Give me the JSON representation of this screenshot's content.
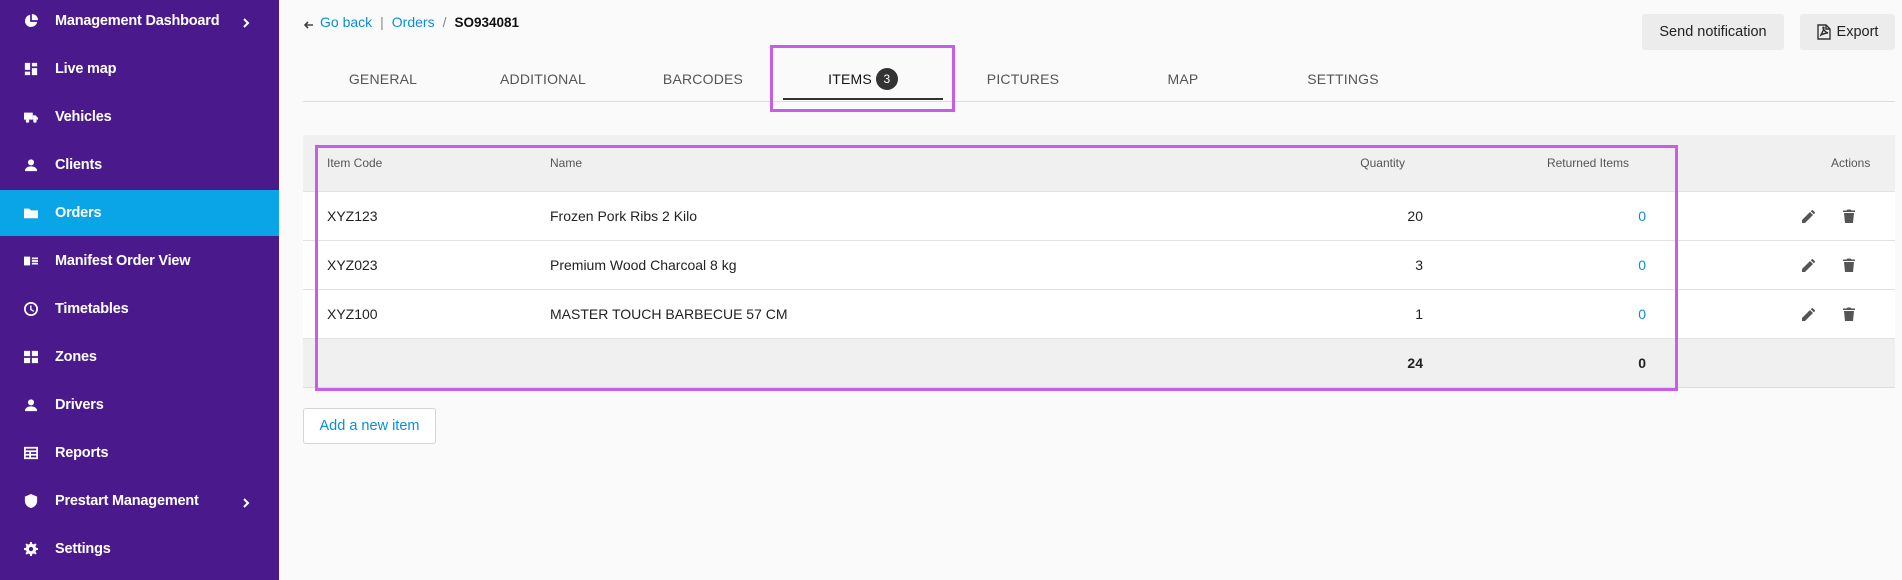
{
  "sidebar": {
    "items": [
      {
        "label": "Management Dashboard",
        "icon": "pie-chart-icon",
        "chevron": true
      },
      {
        "label": "Live map",
        "icon": "dashboard-icon",
        "chevron": false
      },
      {
        "label": "Vehicles",
        "icon": "truck-icon",
        "chevron": false
      },
      {
        "label": "Clients",
        "icon": "person-icon",
        "chevron": false
      },
      {
        "label": "Orders",
        "icon": "folder-icon",
        "chevron": false,
        "active": true
      },
      {
        "label": "Manifest Order View",
        "icon": "list-card-icon",
        "chevron": false
      },
      {
        "label": "Timetables",
        "icon": "clock-icon",
        "chevron": false
      },
      {
        "label": "Zones",
        "icon": "grid-icon",
        "chevron": false
      },
      {
        "label": "Drivers",
        "icon": "person-icon",
        "chevron": false
      },
      {
        "label": "Reports",
        "icon": "table-icon",
        "chevron": false
      },
      {
        "label": "Prestart Management",
        "icon": "shield-icon",
        "chevron": true
      },
      {
        "label": "Settings",
        "icon": "gear-icon",
        "chevron": false
      }
    ]
  },
  "breadcrumb": {
    "back_label": "Go back",
    "orders_label": "Orders",
    "separator_pipe": "|",
    "separator_slash": "/",
    "current": "SO934081"
  },
  "toolbar": {
    "notify_label": "Send notification",
    "export_label": "Export"
  },
  "tabs": [
    {
      "label": "GENERAL"
    },
    {
      "label": "ADDITIONAL"
    },
    {
      "label": "BARCODES"
    },
    {
      "label": "ITEMS",
      "badge": "3",
      "active": true
    },
    {
      "label": "PICTURES"
    },
    {
      "label": "MAP"
    },
    {
      "label": "SETTINGS"
    }
  ],
  "table": {
    "headers": {
      "code": "Item Code",
      "name": "Name",
      "quantity": "Quantity",
      "returned": "Returned Items",
      "actions": "Actions"
    },
    "rows": [
      {
        "code": "XYZ123",
        "name": "Frozen Pork Ribs 2 Kilo",
        "quantity": "20",
        "returned": "0"
      },
      {
        "code": "XYZ023",
        "name": "Premium Wood Charcoal 8 kg",
        "quantity": "3",
        "returned": "0"
      },
      {
        "code": "XYZ100",
        "name": "MASTER TOUCH BARBECUE 57 CM",
        "quantity": "1",
        "returned": "0"
      }
    ],
    "totals": {
      "quantity": "24",
      "returned": "0"
    }
  },
  "add_item_label": "Add a new item",
  "colors": {
    "sidebar": "#4a1a8c",
    "active": "#0aa5e6",
    "link": "#0a8fd6",
    "highlight": "#c75ee8"
  }
}
